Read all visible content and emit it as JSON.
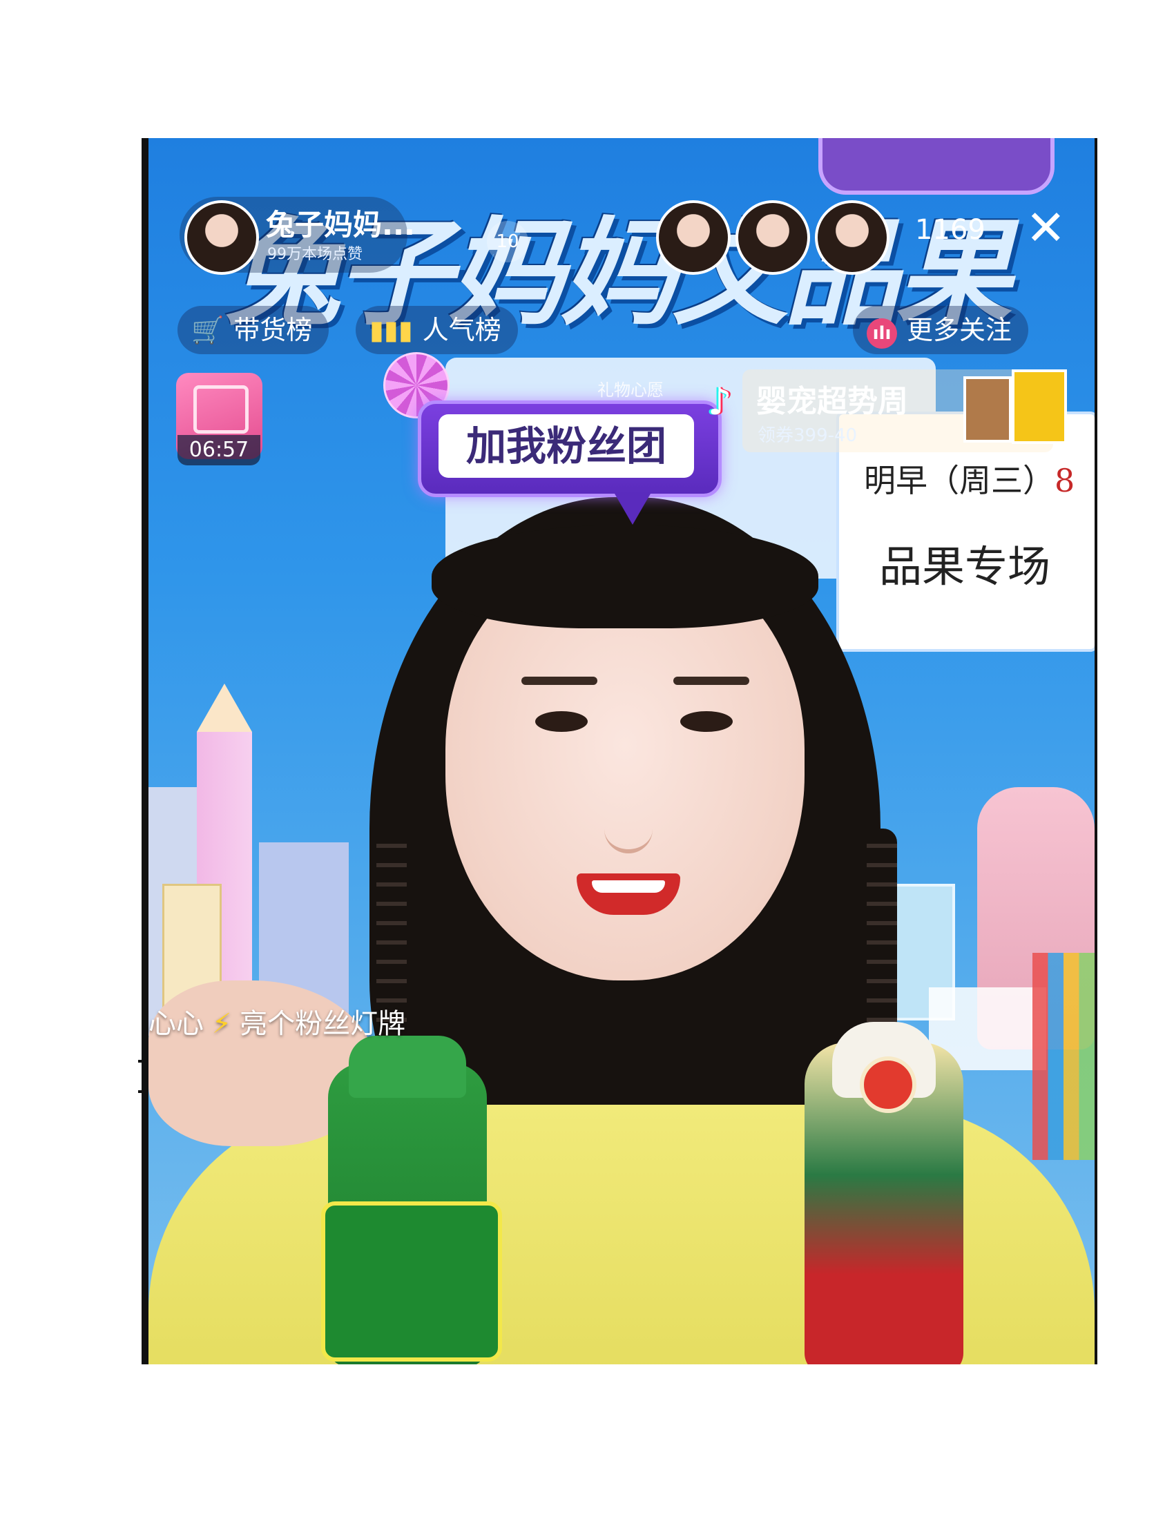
{
  "stream": {
    "banner_title": "兔子妈妈文品果",
    "background_notice": {
      "line1_prefix": "明早（周三）",
      "line1_highlight": "8",
      "line2": "品果专场"
    }
  },
  "header": {
    "host_name": "兔子妈妈...",
    "host_subtitle": "99万本场点赞",
    "rank_badge": "10",
    "viewer_count": "1169",
    "close_icon": "close-icon"
  },
  "chips": {
    "sales_label": "带货榜",
    "popularity_label": "人气榜",
    "follow_label": "更多关注"
  },
  "side_badge": {
    "timer": "06:57"
  },
  "fan_club": {
    "gift_hint": "礼物心愿",
    "label": "加我粉丝团"
  },
  "promo": {
    "title": "婴宠超势周",
    "coupon": "领券399-40"
  },
  "comment": {
    "text_prefix": "心心",
    "text_suffix": "亮个粉丝灯牌"
  },
  "colors": {
    "stream_blue": "#2f95ea",
    "fan_purple": "#6a34d0",
    "chip_accent": "#ffd54a",
    "shirt_yellow": "#efe66f"
  }
}
